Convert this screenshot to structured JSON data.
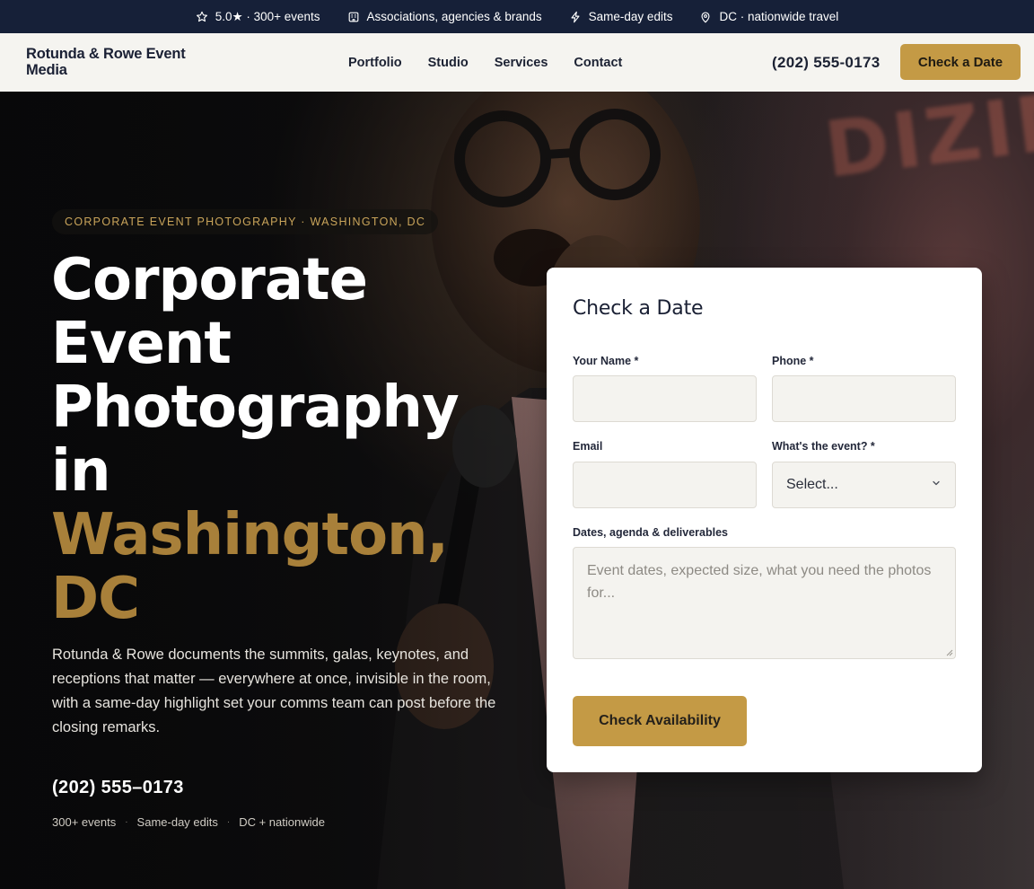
{
  "topbar": {
    "items": [
      {
        "icon": "star-icon",
        "text": "5.0★ · 300+ events"
      },
      {
        "icon": "building-icon",
        "text": "Associations, agencies & brands"
      },
      {
        "icon": "bolt-icon",
        "text": "Same-day edits"
      },
      {
        "icon": "map-pin-icon",
        "text": "DC · nationwide travel"
      }
    ]
  },
  "nav": {
    "logo_line1": "Rotunda & Rowe Event",
    "logo_line2": "Media",
    "links": [
      "Portfolio",
      "Studio",
      "Services",
      "Contact"
    ],
    "phone": "(202) 555-0173",
    "cta": "Check a Date"
  },
  "hero": {
    "eyebrow": "CORPORATE EVENT PHOTOGRAPHY · WASHINGTON, DC",
    "title_lines": [
      "Corporate",
      "Event",
      "Photography",
      "in"
    ],
    "title_accent_lines": [
      "Washington,",
      "DC"
    ],
    "lede": "Rotunda & Rowe documents the summits, galas, keynotes, and receptions that matter — everywhere at once, invisible in the room, with a same-day highlight set your comms team can post before the closing remarks.",
    "phone": "(202) 555–0173",
    "stats": [
      "300+ events",
      "Same-day edits",
      "DC + nationwide"
    ],
    "stats_separator": "·"
  },
  "form": {
    "title": "Check a Date",
    "name_label": "Your Name *",
    "name_value": "",
    "phone_label": "Phone *",
    "phone_value": "",
    "email_label": "Email",
    "email_value": "",
    "event_label": "What's the event? *",
    "event_selected": "Select...",
    "details_label": "Dates, agenda & deliverables",
    "details_placeholder": "Event dates, expected size, what you need the photos for...",
    "submit_label": "Check Availability"
  },
  "colors": {
    "topbar_bg": "#162038",
    "nav_bg": "#f5f4f0",
    "accent_gold": "#c49a45",
    "headline_gold": "#a8803a"
  }
}
